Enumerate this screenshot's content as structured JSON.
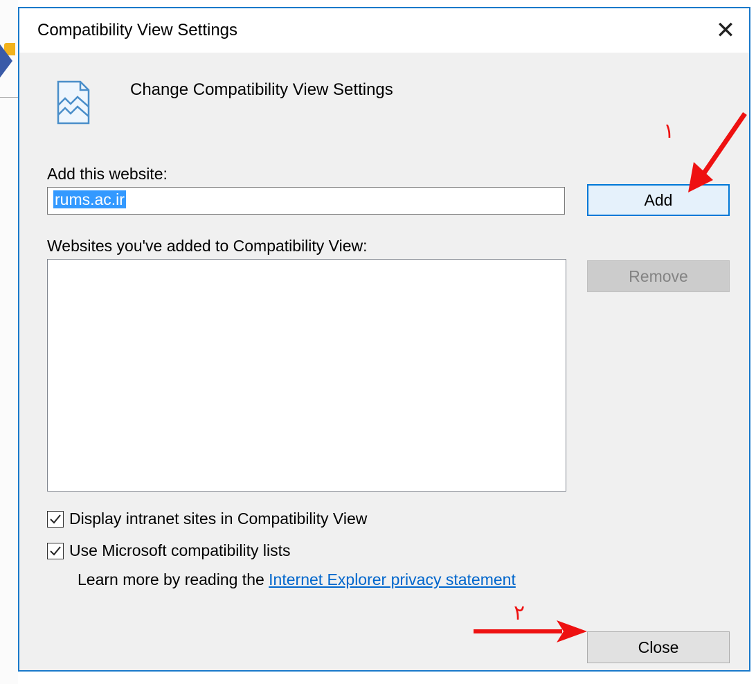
{
  "dialog": {
    "title": "Compatibility View Settings",
    "close_glyph": "✕",
    "header_text": "Change Compatibility View Settings",
    "add_label": "Add this website:",
    "url_value": "rums.ac.ir",
    "add_button": "Add",
    "list_label": "Websites you've added to Compatibility View:",
    "sites": [],
    "remove_button": "Remove",
    "options": [
      {
        "label": "Display intranet sites in Compatibility View",
        "checked": true
      },
      {
        "label": "Use Microsoft compatibility lists",
        "checked": true
      }
    ],
    "learn_prefix": "Learn more by reading the ",
    "learn_link": "Internet Explorer privacy statement",
    "close_button": "Close"
  },
  "annotations": {
    "step1_label": "۱",
    "step2_label": "۲",
    "arrow_color": "#ee1111"
  }
}
